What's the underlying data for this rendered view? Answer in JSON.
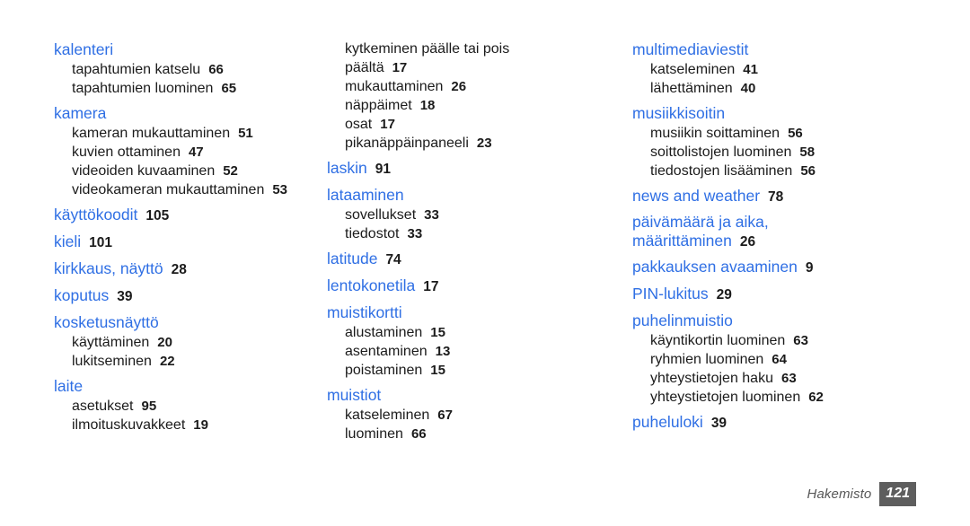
{
  "document": {
    "title": "Hakemisto",
    "page_number": "121",
    "accent_color": "#2f6fe4",
    "text_color": "#1b1b1b",
    "footer_color": "#575757",
    "page_badge_background": "#5e5e5e",
    "background_color": "#ffffff"
  },
  "columns": [
    {
      "id": "column-1",
      "entries": [
        {
          "heading": "kalenteri",
          "page": "",
          "subitems": [
            {
              "label": "tapahtumien katselu",
              "page": "66"
            },
            {
              "label": "tapahtumien luominen",
              "page": "65"
            }
          ]
        },
        {
          "heading": "kamera",
          "page": "",
          "subitems": [
            {
              "label": "kameran mukauttaminen",
              "page": "51"
            },
            {
              "label": "kuvien ottaminen",
              "page": "47"
            },
            {
              "label": "videoiden kuvaaminen",
              "page": "52"
            },
            {
              "label": "videokameran mukauttaminen",
              "page": "53"
            }
          ]
        },
        {
          "heading": "käyttökoodit",
          "page": "105",
          "subitems": []
        },
        {
          "heading": "kieli",
          "page": "101",
          "subitems": []
        },
        {
          "heading": "kirkkaus, näyttö",
          "page": "28",
          "subitems": []
        },
        {
          "heading": "koputus",
          "page": "39",
          "subitems": []
        },
        {
          "heading": "kosketusnäyttö",
          "page": "",
          "subitems": [
            {
              "label": "käyttäminen",
              "page": "20"
            },
            {
              "label": "lukitseminen",
              "page": "22"
            }
          ]
        },
        {
          "heading": "laite",
          "page": "",
          "subitems": [
            {
              "label": "asetukset",
              "page": "95"
            },
            {
              "label": "ilmoituskuvakkeet",
              "page": "19"
            }
          ]
        }
      ]
    },
    {
      "id": "column-2",
      "continued_subitems": [
        {
          "label": "kytkeminen päälle tai pois päältä",
          "page": "17",
          "wrap": true
        },
        {
          "label": "mukauttaminen",
          "page": "26"
        },
        {
          "label": "näppäimet",
          "page": "18"
        },
        {
          "label": "osat",
          "page": "17"
        },
        {
          "label": "pikanäppäinpaneeli",
          "page": "23"
        }
      ],
      "entries": [
        {
          "heading": "laskin",
          "page": "91",
          "subitems": []
        },
        {
          "heading": "lataaminen",
          "page": "",
          "subitems": [
            {
              "label": "sovellukset",
              "page": "33"
            },
            {
              "label": "tiedostot",
              "page": "33"
            }
          ]
        },
        {
          "heading": "latitude",
          "page": "74",
          "subitems": []
        },
        {
          "heading": "lentokonetila",
          "page": "17",
          "subitems": []
        },
        {
          "heading": "muistikortti",
          "page": "",
          "subitems": [
            {
              "label": "alustaminen",
              "page": "15"
            },
            {
              "label": "asentaminen",
              "page": "13"
            },
            {
              "label": "poistaminen",
              "page": "15"
            }
          ]
        },
        {
          "heading": "muistiot",
          "page": "",
          "subitems": [
            {
              "label": "katseleminen",
              "page": "67"
            },
            {
              "label": "luominen",
              "page": "66"
            }
          ]
        }
      ]
    },
    {
      "id": "column-3",
      "entries": [
        {
          "heading": "multimediaviestit",
          "page": "",
          "subitems": [
            {
              "label": "katseleminen",
              "page": "41"
            },
            {
              "label": "lähettäminen",
              "page": "40"
            }
          ]
        },
        {
          "heading": "musiikkisoitin",
          "page": "",
          "subitems": [
            {
              "label": "musiikin soittaminen",
              "page": "56"
            },
            {
              "label": "soittolistojen luominen",
              "page": "58"
            },
            {
              "label": "tiedostojen lisääminen",
              "page": "56"
            }
          ]
        },
        {
          "heading": "news and weather",
          "page": "78",
          "subitems": []
        },
        {
          "heading": "päivämäärä ja aika, määrittäminen",
          "page": "26",
          "subitems": [],
          "two_line": true
        },
        {
          "heading": "pakkauksen avaaminen",
          "page": "9",
          "subitems": []
        },
        {
          "heading": "PIN-lukitus",
          "page": "29",
          "subitems": []
        },
        {
          "heading": "puhelinmuistio",
          "page": "",
          "subitems": [
            {
              "label": "käyntikortin luominen",
              "page": "63"
            },
            {
              "label": "ryhmien luominen",
              "page": "64"
            },
            {
              "label": "yhteystietojen haku",
              "page": "63"
            },
            {
              "label": "yhteystietojen luominen",
              "page": "62"
            }
          ]
        },
        {
          "heading": "puheluloki",
          "page": "39",
          "subitems": []
        }
      ]
    }
  ]
}
